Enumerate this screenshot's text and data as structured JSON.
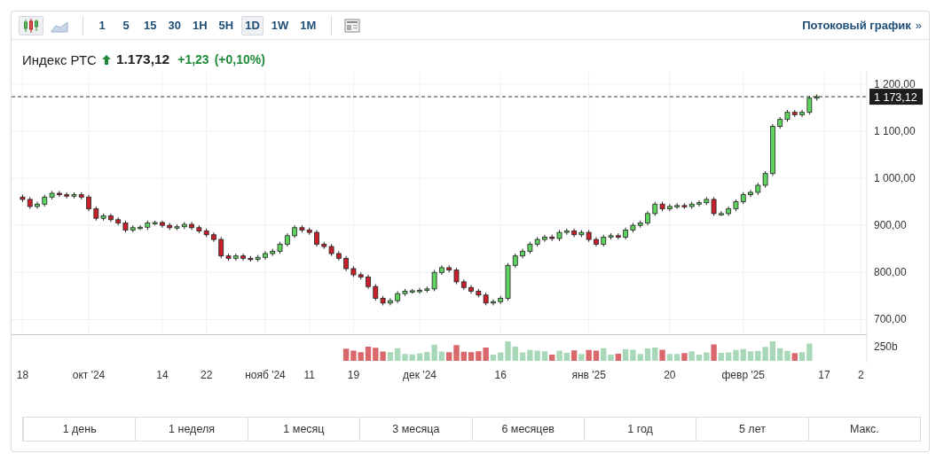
{
  "toolbar": {
    "chart_types": [
      {
        "kind": "candles",
        "selected": true
      },
      {
        "kind": "area",
        "selected": false
      }
    ],
    "intervals": [
      {
        "label": "1",
        "selected": false
      },
      {
        "label": "5",
        "selected": false
      },
      {
        "label": "15",
        "selected": false
      },
      {
        "label": "30",
        "selected": false
      },
      {
        "label": "1H",
        "selected": false
      },
      {
        "label": "5H",
        "selected": false
      },
      {
        "label": "1D",
        "selected": true
      },
      {
        "label": "1W",
        "selected": false
      },
      {
        "label": "1M",
        "selected": false
      }
    ],
    "stream_link": "Потоковый график",
    "stream_link_arrow": "»"
  },
  "quote": {
    "name": "Индекс РТС",
    "rising": true,
    "price": "1.173,12",
    "change": "+1,23",
    "change_percent": "(+0,10%)"
  },
  "chart": {
    "volume_tick": "250b",
    "chart_data": {
      "type": "candlestick",
      "grid": true,
      "ylim": [
        668.7,
        1226
      ],
      "yticks": [
        {
          "value": 700,
          "label": "700,00"
        },
        {
          "value": 800,
          "label": "800,00"
        },
        {
          "value": 900,
          "label": "900,00"
        },
        {
          "value": 1000,
          "label": "1 000,00"
        },
        {
          "value": 1100,
          "label": "1 100,00"
        },
        {
          "value": 1200,
          "label": "1 200,00"
        }
      ],
      "categories": [
        "18",
        null,
        null,
        null,
        null,
        null,
        null,
        null,
        null,
        "окт '24",
        null,
        null,
        null,
        null,
        null,
        null,
        null,
        null,
        null,
        "14",
        null,
        null,
        null,
        null,
        null,
        "22",
        null,
        null,
        null,
        null,
        null,
        null,
        null,
        "нояб '24",
        null,
        null,
        null,
        null,
        null,
        "11",
        null,
        null,
        null,
        null,
        null,
        "19",
        null,
        null,
        null,
        null,
        null,
        null,
        null,
        null,
        "дек '24",
        null,
        null,
        null,
        null,
        null,
        null,
        null,
        null,
        null,
        null,
        "16",
        null,
        null,
        null,
        null,
        null,
        null,
        null,
        null,
        null,
        null,
        null,
        "янв '25",
        null,
        null,
        null,
        null,
        null,
        null,
        null,
        null,
        null,
        null,
        "20",
        null,
        null,
        null,
        null,
        null,
        null,
        null,
        null,
        null,
        "февр '25",
        null,
        null,
        null,
        null,
        null,
        null,
        null,
        null,
        null,
        null,
        "17",
        null,
        null,
        null,
        null,
        "2"
      ],
      "ohlc": [
        [
          960,
          965,
          950,
          955
        ],
        [
          955,
          960,
          935,
          940
        ],
        [
          940,
          950,
          935,
          945
        ],
        [
          945,
          965,
          940,
          960
        ],
        [
          960,
          973,
          955,
          968
        ],
        [
          968,
          973,
          960,
          965
        ],
        [
          965,
          970,
          957,
          962
        ],
        [
          962,
          970,
          957,
          965
        ],
        [
          965,
          970,
          955,
          960
        ],
        [
          960,
          965,
          930,
          935
        ],
        [
          935,
          940,
          910,
          915
        ],
        [
          915,
          925,
          910,
          920
        ],
        [
          920,
          925,
          907,
          912
        ],
        [
          912,
          917,
          900,
          905
        ],
        [
          905,
          910,
          885,
          890
        ],
        [
          890,
          900,
          885,
          895
        ],
        [
          895,
          900,
          890,
          896
        ],
        [
          896,
          910,
          890,
          905
        ],
        [
          905,
          910,
          900,
          906
        ],
        [
          906,
          910,
          895,
          900
        ],
        [
          900,
          905,
          890,
          895
        ],
        [
          895,
          902,
          890,
          897
        ],
        [
          897,
          907,
          892,
          902
        ],
        [
          902,
          907,
          890,
          895
        ],
        [
          895,
          900,
          883,
          888
        ],
        [
          888,
          893,
          875,
          880
        ],
        [
          880,
          885,
          865,
          870
        ],
        [
          870,
          875,
          830,
          835
        ],
        [
          835,
          840,
          825,
          830
        ],
        [
          830,
          840,
          825,
          835
        ],
        [
          835,
          840,
          825,
          830
        ],
        [
          830,
          835,
          823,
          828
        ],
        [
          828,
          837,
          823,
          832
        ],
        [
          832,
          845,
          827,
          840
        ],
        [
          840,
          850,
          835,
          845
        ],
        [
          845,
          865,
          840,
          860
        ],
        [
          860,
          883,
          855,
          878
        ],
        [
          878,
          900,
          873,
          895
        ],
        [
          895,
          900,
          885,
          890
        ],
        [
          890,
          895,
          880,
          885
        ],
        [
          885,
          890,
          855,
          860
        ],
        [
          860,
          865,
          850,
          855
        ],
        [
          855,
          860,
          835,
          840
        ],
        [
          840,
          845,
          825,
          830
        ],
        [
          830,
          835,
          803,
          808
        ],
        [
          808,
          813,
          790,
          795
        ],
        [
          795,
          800,
          785,
          790
        ],
        [
          790,
          795,
          765,
          770
        ],
        [
          770,
          775,
          740,
          745
        ],
        [
          745,
          750,
          730,
          735
        ],
        [
          735,
          745,
          730,
          740
        ],
        [
          740,
          760,
          735,
          755
        ],
        [
          755,
          765,
          750,
          760
        ],
        [
          760,
          765,
          755,
          761
        ],
        [
          761,
          767,
          755,
          762
        ],
        [
          762,
          770,
          757,
          765
        ],
        [
          765,
          805,
          760,
          800
        ],
        [
          800,
          815,
          795,
          810
        ],
        [
          810,
          815,
          800,
          805
        ],
        [
          805,
          810,
          775,
          780
        ],
        [
          780,
          785,
          763,
          768
        ],
        [
          768,
          773,
          755,
          760
        ],
        [
          760,
          765,
          747,
          752
        ],
        [
          752,
          757,
          730,
          735
        ],
        [
          735,
          743,
          730,
          738
        ],
        [
          738,
          750,
          733,
          745
        ],
        [
          745,
          820,
          740,
          815
        ],
        [
          815,
          840,
          810,
          835
        ],
        [
          835,
          850,
          830,
          845
        ],
        [
          845,
          865,
          840,
          860
        ],
        [
          860,
          875,
          855,
          870
        ],
        [
          870,
          880,
          865,
          875
        ],
        [
          875,
          880,
          867,
          872
        ],
        [
          872,
          890,
          867,
          885
        ],
        [
          885,
          893,
          880,
          888
        ],
        [
          888,
          893,
          875,
          880
        ],
        [
          880,
          890,
          875,
          885
        ],
        [
          885,
          890,
          865,
          870
        ],
        [
          870,
          875,
          855,
          860
        ],
        [
          860,
          880,
          855,
          875
        ],
        [
          875,
          883,
          870,
          878
        ],
        [
          878,
          883,
          870,
          875
        ],
        [
          875,
          895,
          870,
          890
        ],
        [
          890,
          905,
          885,
          900
        ],
        [
          900,
          910,
          895,
          905
        ],
        [
          905,
          930,
          900,
          925
        ],
        [
          925,
          950,
          920,
          945
        ],
        [
          945,
          950,
          930,
          935
        ],
        [
          935,
          945,
          930,
          940
        ],
        [
          940,
          947,
          935,
          942
        ],
        [
          942,
          947,
          935,
          940
        ],
        [
          940,
          950,
          935,
          945
        ],
        [
          945,
          953,
          940,
          948
        ],
        [
          948,
          960,
          943,
          955
        ],
        [
          955,
          960,
          920,
          925
        ],
        [
          925,
          930,
          920,
          925
        ],
        [
          925,
          940,
          920,
          935
        ],
        [
          935,
          955,
          930,
          950
        ],
        [
          950,
          970,
          945,
          965
        ],
        [
          965,
          975,
          960,
          970
        ],
        [
          970,
          990,
          965,
          985
        ],
        [
          985,
          1015,
          980,
          1010
        ],
        [
          1010,
          1115,
          1005,
          1110
        ],
        [
          1110,
          1130,
          1105,
          1125
        ],
        [
          1125,
          1145,
          1120,
          1140
        ],
        [
          1140,
          1145,
          1130,
          1135
        ],
        [
          1135,
          1145,
          1130,
          1140
        ],
        [
          1140,
          1175,
          1135,
          1170
        ],
        [
          1170,
          1178,
          1165,
          1173.12
        ],
        null,
        null,
        null,
        null,
        null,
        null
      ],
      "ref_lines": [
        {
          "axis": "y",
          "value": 1173.12,
          "label": "1 173,12"
        }
      ]
    }
  },
  "ranges": [
    {
      "label": "1 день"
    },
    {
      "label": "1 неделя"
    },
    {
      "label": "1 месяц"
    },
    {
      "label": "3 месяца"
    },
    {
      "label": "6 месяцев"
    },
    {
      "label": "1 год"
    },
    {
      "label": "5 лет"
    },
    {
      "label": "Макс."
    }
  ]
}
